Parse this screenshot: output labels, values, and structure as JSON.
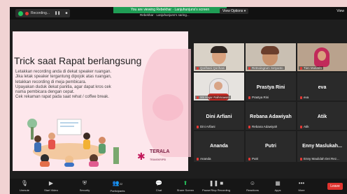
{
  "topbar": {
    "recording_label": "Recording...",
    "pause_icon": "pause-icon",
    "stop_icon": "stop-icon",
    "banner": "You are viewing Rebekhar · Lanjuhunjuns's screen",
    "subbanner": "Rebekhar · Lanjuhunjuns's saring...",
    "view_options": "View Options ▾",
    "view_right": "View"
  },
  "slide": {
    "title": "Trick saat Rapat berlangsung",
    "lines": [
      "Letakkan recording anda di dekat speaker ruangan.",
      "Jika letak speaker tergantung dipojok atas ruangan,",
      "letakkan recording di meja pembicara.",
      "Upayakan duduk dekat panitia, agar dapat kros cek",
      "nama pembicara dengan cepat.",
      "Cek rekaman rapat pada saat rehat / coffee break."
    ],
    "logo_line1": "TERALA",
    "logo_line2": "",
    "logo_sub": "TRANSKRIPSI"
  },
  "participants": [
    {
      "name": "Qorihani Qorihani",
      "big": "",
      "video": true
    },
    {
      "name": "Retnoingrum Setyanto",
      "big": "",
      "video": true
    },
    {
      "name": "Tien Mutiarin",
      "big": "",
      "video": true
    },
    {
      "name": "SS Hajar Rahmawati",
      "big": "",
      "video": true
    },
    {
      "name": "Prastya Rini",
      "big": "Prastya Rini",
      "video": false
    },
    {
      "name": "eva",
      "big": "eva",
      "video": false
    },
    {
      "name": "Dini Arfiani",
      "big": "Dini Arfiani",
      "video": false
    },
    {
      "name": "Rebana Adawiyah",
      "big": "Rebana Adawiyah",
      "video": false
    },
    {
      "name": "Atik",
      "big": "Atik",
      "video": false
    },
    {
      "name": "Ananda",
      "big": "Ananda",
      "video": false
    },
    {
      "name": "Putri",
      "big": "Putri",
      "video": false
    },
    {
      "name": "Enny Maulidah Dei Rez...",
      "big": "Enny Maslukah...",
      "video": false
    }
  ],
  "toolbar": {
    "unmute": "Unmute",
    "start_video": "Start Video",
    "security": "Security",
    "participants": "Participants",
    "participants_count": "22",
    "chat": "Chat",
    "share_screen": "Share Screen",
    "record": "Pause/Stop Recording",
    "reactions": "Reactions",
    "apps": "Apps",
    "more": "More",
    "leave": "Leave"
  }
}
